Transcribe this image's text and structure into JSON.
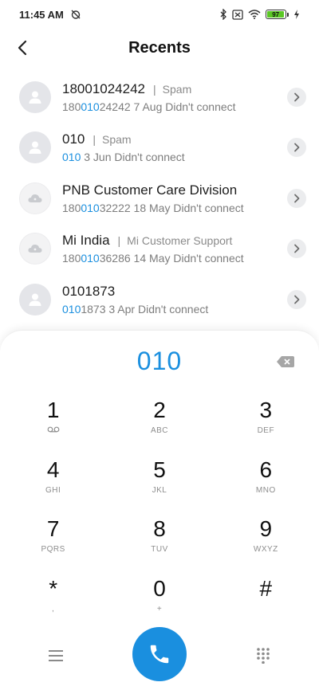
{
  "status_bar": {
    "time": "11:45 AM",
    "battery": "97",
    "battery_level": 0.97,
    "icons": [
      "alarm-off-icon",
      "bluetooth-icon",
      "sim-icon",
      "wifi-icon",
      "battery-icon",
      "charging-icon"
    ]
  },
  "header": {
    "title": "Recents"
  },
  "recents": [
    {
      "name": "18001024242",
      "tag": "Spam",
      "num_pre": "180",
      "num_hl": "010",
      "num_post": "24242",
      "info": "7 Aug Didn't connect",
      "avatar": "person-icon"
    },
    {
      "name": "010",
      "tag": "Spam",
      "num_pre": "",
      "num_hl": "010",
      "num_post": "",
      "info": "3 Jun Didn't connect",
      "avatar": "person-icon"
    },
    {
      "name": "PNB Customer Care Division",
      "tag": "",
      "num_pre": "180",
      "num_hl": "010",
      "num_post": "32222",
      "info": "18 May Didn't connect",
      "avatar": "cloud-logo-icon"
    },
    {
      "name": "Mi India",
      "tag": "Mi Customer Support",
      "num_pre": "180",
      "num_hl": "010",
      "num_post": "36286",
      "info": "14 May Didn't connect",
      "avatar": "cloud-logo-icon"
    },
    {
      "name": "0101873",
      "tag": "",
      "num_pre": "",
      "num_hl": "010",
      "num_post": "1873",
      "info": "3 Apr Didn't connect",
      "avatar": "person-icon"
    }
  ],
  "dialer": {
    "dialed_number": "010",
    "keys": [
      [
        {
          "digit": "1",
          "letters": "voicemail"
        },
        {
          "digit": "2",
          "letters": "ABC"
        },
        {
          "digit": "3",
          "letters": "DEF"
        }
      ],
      [
        {
          "digit": "4",
          "letters": "GHI"
        },
        {
          "digit": "5",
          "letters": "JKL"
        },
        {
          "digit": "6",
          "letters": "MNO"
        }
      ],
      [
        {
          "digit": "7",
          "letters": "PQRS"
        },
        {
          "digit": "8",
          "letters": "TUV"
        },
        {
          "digit": "9",
          "letters": "WXYZ"
        }
      ],
      [
        {
          "digit": "*",
          "letters": ","
        },
        {
          "digit": "0",
          "letters": "+"
        },
        {
          "digit": "#",
          "letters": ""
        }
      ]
    ]
  },
  "colors": {
    "accent": "#1a8fdf",
    "battery_green": "#5ac724"
  }
}
